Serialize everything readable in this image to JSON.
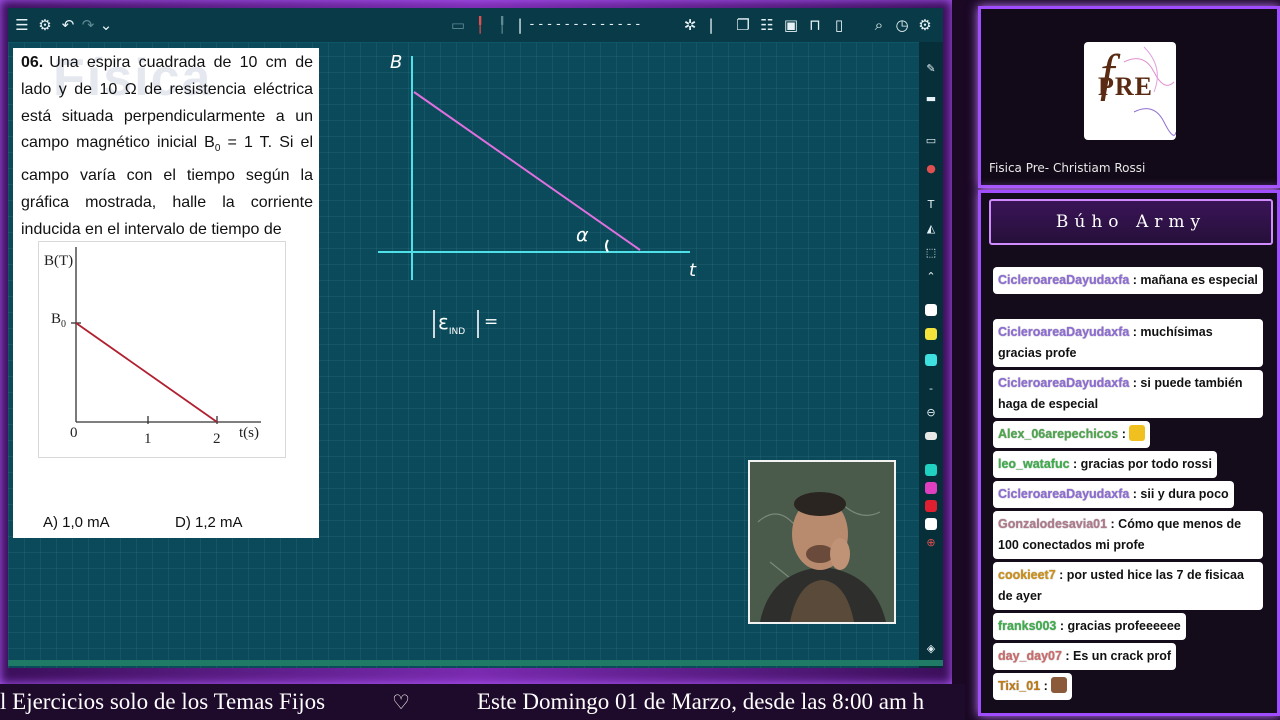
{
  "problem": {
    "number": "06.",
    "text": "Una espira cuadrada de 10 cm de lado y de 10 Ω de resistencia eléctrica está situada perpendicularmente a un campo magnético inicial B",
    "text_sub": "0",
    "text_tail": " = 1 T. Si el campo varía con el tiempo según la gráfica mostrada, halle la corriente inducida en el intervalo de tiempo de",
    "watermark": "Física",
    "graph": {
      "y_axis_label": "B(T)",
      "y_tick_label": "B",
      "y_tick_sub": "0",
      "x_ticks": [
        "0",
        "1",
        "2"
      ],
      "x_axis_label": "t(s)"
    },
    "answers": [
      {
        "label": "A) 1,0 mA"
      },
      {
        "label": "D) 1,2 mA"
      }
    ]
  },
  "whiteboard": {
    "y_label": "B",
    "x_label": "t",
    "angle_label": "α",
    "emf_label": "|ε",
    "emf_sub": "IND",
    "emf_tail": "| ="
  },
  "channel": {
    "logo_text": "PRE",
    "logo_f": "f",
    "name": "Fisica Pre- Christiam Rossi"
  },
  "chat": {
    "title": "Búho Army",
    "messages": [
      {
        "user": "CicleroareaDayudaxfa",
        "text": " : mañana es especial",
        "color": "#8e6bd9"
      },
      {
        "user": "CicleroareaDayudaxfa",
        "text": " : muchísimas gracias profe",
        "color": "#8e6bd9"
      },
      {
        "user": "CicleroareaDayudaxfa",
        "text": " : si puede también haga de especial",
        "color": "#8e6bd9"
      },
      {
        "user": "Alex_06arepechicos",
        "text": " : ",
        "color": "#4aa84a",
        "emoji": "#f0c020"
      },
      {
        "user": "leo_watafuc",
        "text": " : gracias por todo rossi",
        "color": "#3bb04a"
      },
      {
        "user": "CicleroareaDayudaxfa",
        "text": " : sii y dura poco",
        "color": "#8e6bd9"
      },
      {
        "user": "Gonzalodesavia01",
        "text": " : Cómo que menos de 100 conectados mi profe",
        "color": "#b07a8a"
      },
      {
        "user": "cookieet7",
        "text": " : por usted hice las 7 de fisicaa de ayer",
        "color": "#d09010"
      },
      {
        "user": "franks003",
        "text": " : gracias profeeeeee",
        "color": "#3bb04a"
      },
      {
        "user": "day_day07",
        "text": " : Es un crack prof",
        "color": "#d06a6a"
      },
      {
        "user": "Tixi_01",
        "text": " : ",
        "color": "#c07a10",
        "emoji": "#8a5a3a"
      }
    ]
  },
  "ticker": {
    "part_a": "l Ejercicios solo de los Temas Fijos",
    "heart": "♡",
    "part_b": "Este Domingo 01 de Marzo, desde las 8:00 am h"
  },
  "colors": {
    "board": "#0b4a5a",
    "axis_cyan": "#4fe0e8",
    "line_pink": "#e070e0",
    "graph_line": "#b02030",
    "frame_purple": "#a04cff"
  }
}
